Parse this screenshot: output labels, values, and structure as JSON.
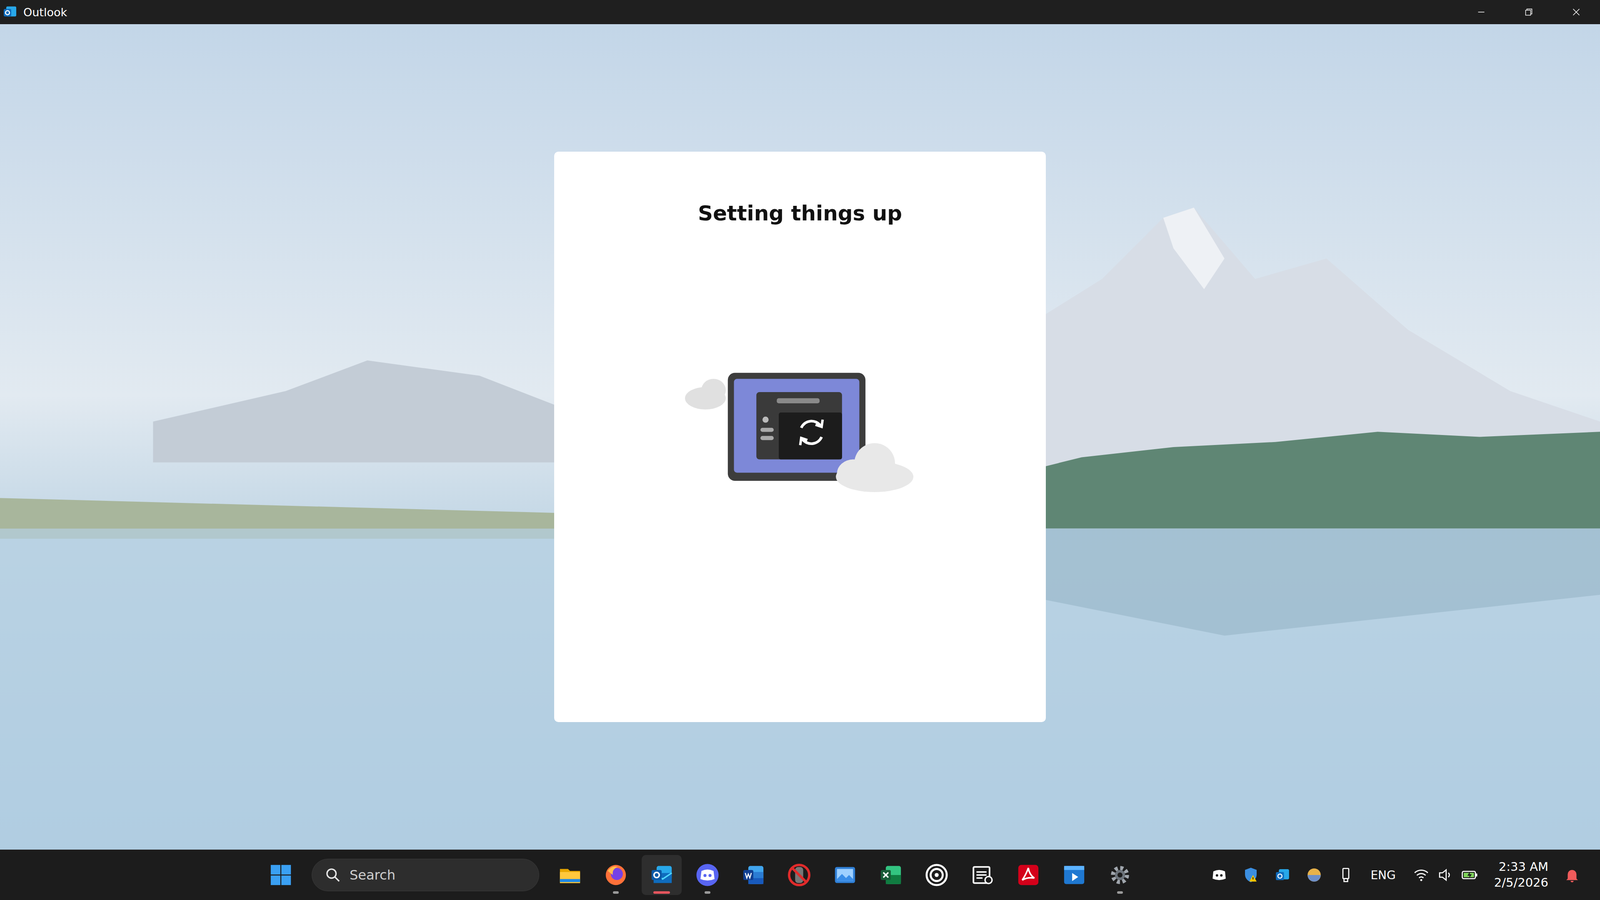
{
  "window": {
    "title": "Outlook"
  },
  "setup": {
    "title": "Setting things up"
  },
  "taskbar": {
    "search": {
      "placeholder": "Search"
    },
    "apps": [
      {
        "kind": "explorer",
        "running": false,
        "selected": false
      },
      {
        "kind": "firefox",
        "running": true,
        "selected": false
      },
      {
        "kind": "outlook",
        "running": true,
        "selected": true
      },
      {
        "kind": "discord",
        "running": true,
        "selected": false
      },
      {
        "kind": "word",
        "running": false,
        "selected": false
      },
      {
        "kind": "blocked",
        "running": false,
        "selected": false
      },
      {
        "kind": "mail",
        "running": false,
        "selected": false
      },
      {
        "kind": "excel",
        "running": false,
        "selected": false
      },
      {
        "kind": "ubisoft",
        "running": false,
        "selected": false
      },
      {
        "kind": "reader",
        "running": false,
        "selected": false
      },
      {
        "kind": "acrobat",
        "running": false,
        "selected": false
      },
      {
        "kind": "media",
        "running": false,
        "selected": false
      },
      {
        "kind": "settings",
        "running": true,
        "selected": false
      }
    ],
    "tray": {
      "icons": [
        {
          "kind": "discord"
        },
        {
          "kind": "defender"
        },
        {
          "kind": "outlook"
        },
        {
          "kind": "sphere"
        },
        {
          "kind": "usb"
        }
      ],
      "language": "ENG",
      "status": [
        {
          "kind": "wifi"
        },
        {
          "kind": "volume"
        },
        {
          "kind": "battery"
        }
      ],
      "time": "2:33 AM",
      "date": "2/5/2026"
    }
  }
}
